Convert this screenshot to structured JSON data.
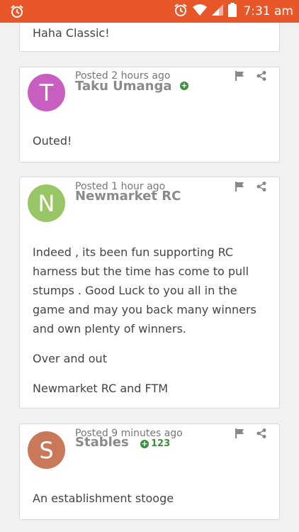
{
  "status_bar": {
    "time": "7:31 am",
    "icons": [
      "alarm-icon",
      "alarm-icon",
      "wifi-icon",
      "signal-icon",
      "battery-icon"
    ],
    "color": "#e8572a"
  },
  "comments": [
    {
      "body": [
        "Haha Classic!"
      ]
    },
    {
      "avatar_letter": "T",
      "avatar_color": "#c85fc0",
      "posted": "Posted 2 hours ago",
      "author": "Taku Umanga",
      "votes": "",
      "body": [
        "Outed!"
      ]
    },
    {
      "avatar_letter": "N",
      "avatar_color": "#98c565",
      "posted": "Posted 1 hour ago",
      "author": "Newmarket RC",
      "votes": "",
      "body": [
        "Indeed , its been fun supporting RC harness but the time has come to pull stumps . Good Luck to you all in the game and may you back many winners and own plenty of winners.",
        "Over and out",
        "Newmarket RC and FTM"
      ]
    },
    {
      "avatar_letter": "S",
      "avatar_color": "#c9785a",
      "posted": "Posted 9 minutes ago",
      "author": "Stables",
      "votes": "123",
      "body": [
        "An establishment stooge"
      ]
    }
  ]
}
